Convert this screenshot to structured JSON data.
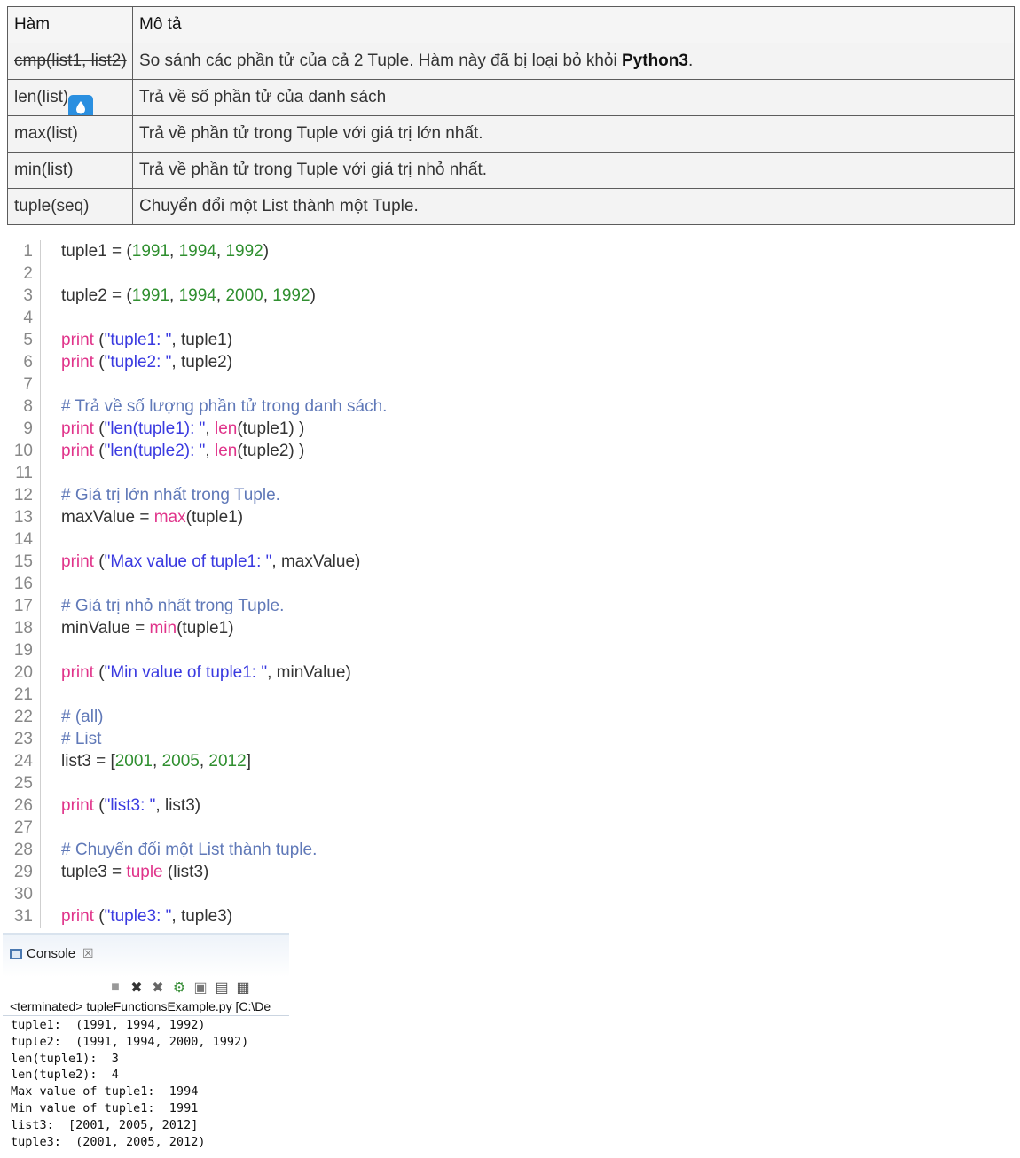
{
  "table": {
    "headers": [
      "Hàm",
      "Mô tả"
    ],
    "rows": [
      {
        "fn": "cmp(list1, list2)",
        "desc_before": "So sánh các phần tử của cả 2 Tuple. Hàm này đã bị loại bỏ khỏi ",
        "desc_bold": "Python3",
        "desc_after": "."
      },
      {
        "fn": "len(list)",
        "desc": "Trả về số phần tử của danh sách"
      },
      {
        "fn": "max(list)",
        "desc": "Trả về phần tử trong Tuple với giá trị lớn nhất."
      },
      {
        "fn": "min(list)",
        "desc": "Trả về phần tử trong Tuple với giá trị nhỏ nhất."
      },
      {
        "fn": "tuple(seq)",
        "desc": "Chuyển đổi một List thành một Tuple."
      }
    ]
  },
  "code": {
    "lines": [
      [
        [
          "t",
          "tuple1 "
        ],
        [
          "t",
          "= ("
        ],
        [
          "n",
          "1991"
        ],
        [
          "t",
          ", "
        ],
        [
          "n",
          "1994"
        ],
        [
          "t",
          ", "
        ],
        [
          "n",
          "1992"
        ],
        [
          "t",
          ")"
        ]
      ],
      [],
      [
        [
          "t",
          "tuple2 "
        ],
        [
          "t",
          "= ("
        ],
        [
          "n",
          "1991"
        ],
        [
          "t",
          ", "
        ],
        [
          "n",
          "1994"
        ],
        [
          "t",
          ", "
        ],
        [
          "n",
          "2000"
        ],
        [
          "t",
          ", "
        ],
        [
          "n",
          "1992"
        ],
        [
          "t",
          ")"
        ]
      ],
      [],
      [
        [
          "k",
          "print"
        ],
        [
          "t",
          " ("
        ],
        [
          "s",
          "\"tuple1: \""
        ],
        [
          "t",
          ", tuple1)"
        ]
      ],
      [
        [
          "k",
          "print"
        ],
        [
          "t",
          " ("
        ],
        [
          "s",
          "\"tuple2: \""
        ],
        [
          "t",
          ", tuple2)"
        ]
      ],
      [],
      [
        [
          "c",
          "# Trả về số lượng phần tử trong danh sách."
        ]
      ],
      [
        [
          "k",
          "print"
        ],
        [
          "t",
          " ("
        ],
        [
          "s",
          "\"len(tuple1): \""
        ],
        [
          "t",
          ", "
        ],
        [
          "k",
          "len"
        ],
        [
          "t",
          "(tuple1) )"
        ]
      ],
      [
        [
          "k",
          "print"
        ],
        [
          "t",
          " ("
        ],
        [
          "s",
          "\"len(tuple2): \""
        ],
        [
          "t",
          ", "
        ],
        [
          "k",
          "len"
        ],
        [
          "t",
          "(tuple2) )"
        ]
      ],
      [],
      [
        [
          "c",
          "# Giá trị lớn nhất trong Tuple."
        ]
      ],
      [
        [
          "t",
          "maxValue "
        ],
        [
          "t",
          "= "
        ],
        [
          "k",
          "max"
        ],
        [
          "t",
          "(tuple1)"
        ]
      ],
      [],
      [
        [
          "k",
          "print"
        ],
        [
          "t",
          " ("
        ],
        [
          "s",
          "\"Max value of tuple1: \""
        ],
        [
          "t",
          ", maxValue)"
        ]
      ],
      [],
      [
        [
          "c",
          "# Giá trị nhỏ nhất trong Tuple."
        ]
      ],
      [
        [
          "t",
          "minValue "
        ],
        [
          "t",
          "= "
        ],
        [
          "k",
          "min"
        ],
        [
          "t",
          "(tuple1)"
        ]
      ],
      [],
      [
        [
          "k",
          "print"
        ],
        [
          "t",
          " ("
        ],
        [
          "s",
          "\"Min value of tuple1: \""
        ],
        [
          "t",
          ", minValue)"
        ]
      ],
      [],
      [
        [
          "c",
          "# (all)"
        ]
      ],
      [
        [
          "c",
          "# List"
        ]
      ],
      [
        [
          "t",
          "list3 "
        ],
        [
          "t",
          "= ["
        ],
        [
          "n",
          "2001"
        ],
        [
          "t",
          ", "
        ],
        [
          "n",
          "2005"
        ],
        [
          "t",
          ", "
        ],
        [
          "n",
          "2012"
        ],
        [
          "t",
          "]"
        ]
      ],
      [],
      [
        [
          "k",
          "print"
        ],
        [
          "t",
          " ("
        ],
        [
          "s",
          "\"list3: \""
        ],
        [
          "t",
          ", list3)"
        ]
      ],
      [],
      [
        [
          "c",
          "# Chuyển đổi một List thành tuple."
        ]
      ],
      [
        [
          "t",
          "tuple3 "
        ],
        [
          "t",
          "= "
        ],
        [
          "k",
          "tuple"
        ],
        [
          "t",
          " (list3)"
        ]
      ],
      [],
      [
        [
          "k",
          "print"
        ],
        [
          "t",
          " ("
        ],
        [
          "s",
          "\"tuple3: \""
        ],
        [
          "t",
          ", tuple3)"
        ]
      ]
    ]
  },
  "console": {
    "tab_label": "Console",
    "tab_close": "☒",
    "toolbar_icons": [
      "■",
      "✖",
      "✖",
      "⚙",
      "▣",
      "▤",
      "▦"
    ],
    "terminated": "<terminated> tupleFunctionsExample.py [C:\\De",
    "output": [
      "tuple1:  (1991, 1994, 1992)",
      "tuple2:  (1991, 1994, 2000, 1992)",
      "len(tuple1):  3",
      "len(tuple2):  4",
      "Max value of tuple1:  1994",
      "Min value of tuple1:  1991",
      "list3:  [2001, 2005, 2012]",
      "tuple3:  (2001, 2005, 2012)"
    ]
  }
}
